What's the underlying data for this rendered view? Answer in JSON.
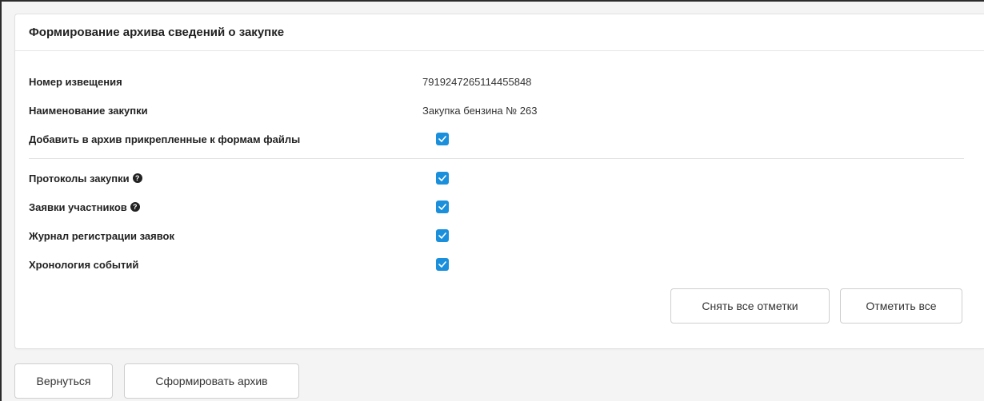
{
  "card": {
    "title": "Формирование архива сведений о закупке"
  },
  "info": {
    "notice_number_label": "Номер извещения",
    "notice_number_value": "7919247265114455848",
    "purchase_name_label": "Наименование закупки",
    "purchase_name_value": "Закупка бензина № 263"
  },
  "options": {
    "attach_files": {
      "label": "Добавить в архив прикрепленные к формам файлы",
      "checked": true
    },
    "items": [
      {
        "label": "Протоколы закупки",
        "help": true,
        "checked": true
      },
      {
        "label": "Заявки участников",
        "help": true,
        "checked": true
      },
      {
        "label": "Журнал регистрации заявок",
        "help": false,
        "checked": true
      },
      {
        "label": "Хронология событий",
        "help": false,
        "checked": true
      }
    ]
  },
  "actions": {
    "uncheck_all_label": "Снять все отметки",
    "check_all_label": "Отметить все",
    "back_label": "Вернуться",
    "build_archive_label": "Сформировать архив"
  },
  "colors": {
    "checkbox_accent": "#1a8fdc",
    "background": "#f4f4f5",
    "card": "#ffffff"
  },
  "icons": {
    "help": "question-circle-icon",
    "check": "check-icon"
  }
}
